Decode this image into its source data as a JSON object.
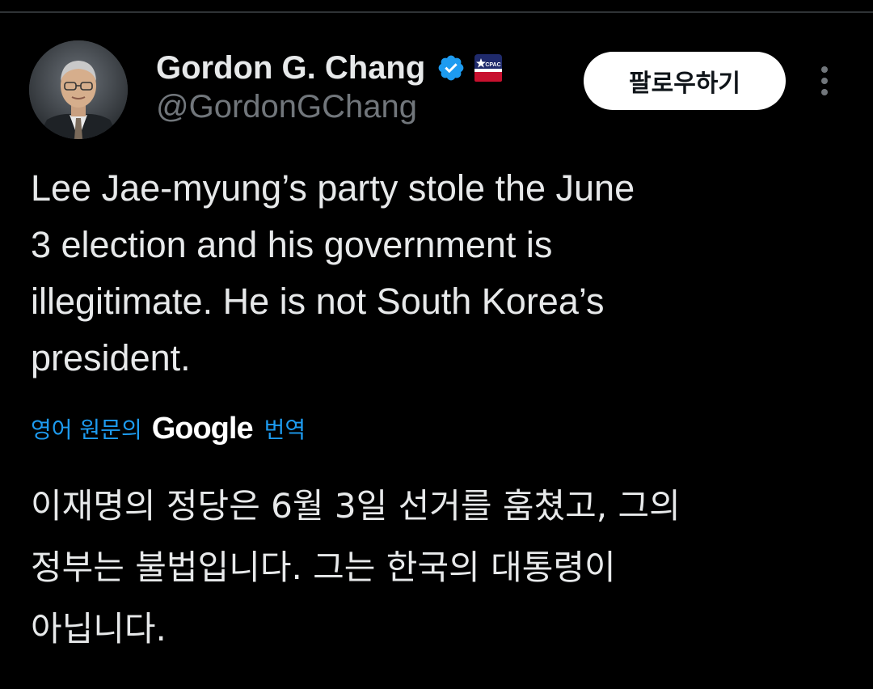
{
  "author": {
    "display_name": "Gordon G. Chang",
    "handle": "@GordonGChang",
    "avatar_icon": "profile-photo",
    "verified_icon": "verified-badge-icon",
    "affiliate_icon": "cpac-badge-icon",
    "affiliate_badge_text": "CPAC"
  },
  "actions": {
    "follow_label": "팔로우하기",
    "more_icon": "more-vertical-icon"
  },
  "tweet": {
    "text": "Lee Jae-myung’s party stole the June\n3 election and his government is\nillegitimate. He is not South Korea’s\npresident."
  },
  "translation": {
    "prefix": "영어 원문의",
    "provider": "Google",
    "suffix": "번역",
    "text": "이재명의 정당은 6월 3일 선거를 훔쳤고, 그의\n정부는 불법입니다. 그는 한국의 대통령이\n아닙니다."
  },
  "colors": {
    "background": "#000000",
    "text_primary": "#e7e9ea",
    "text_secondary": "#71767b",
    "accent_blue": "#1d9bf0",
    "follow_button_bg": "#ffffff"
  }
}
